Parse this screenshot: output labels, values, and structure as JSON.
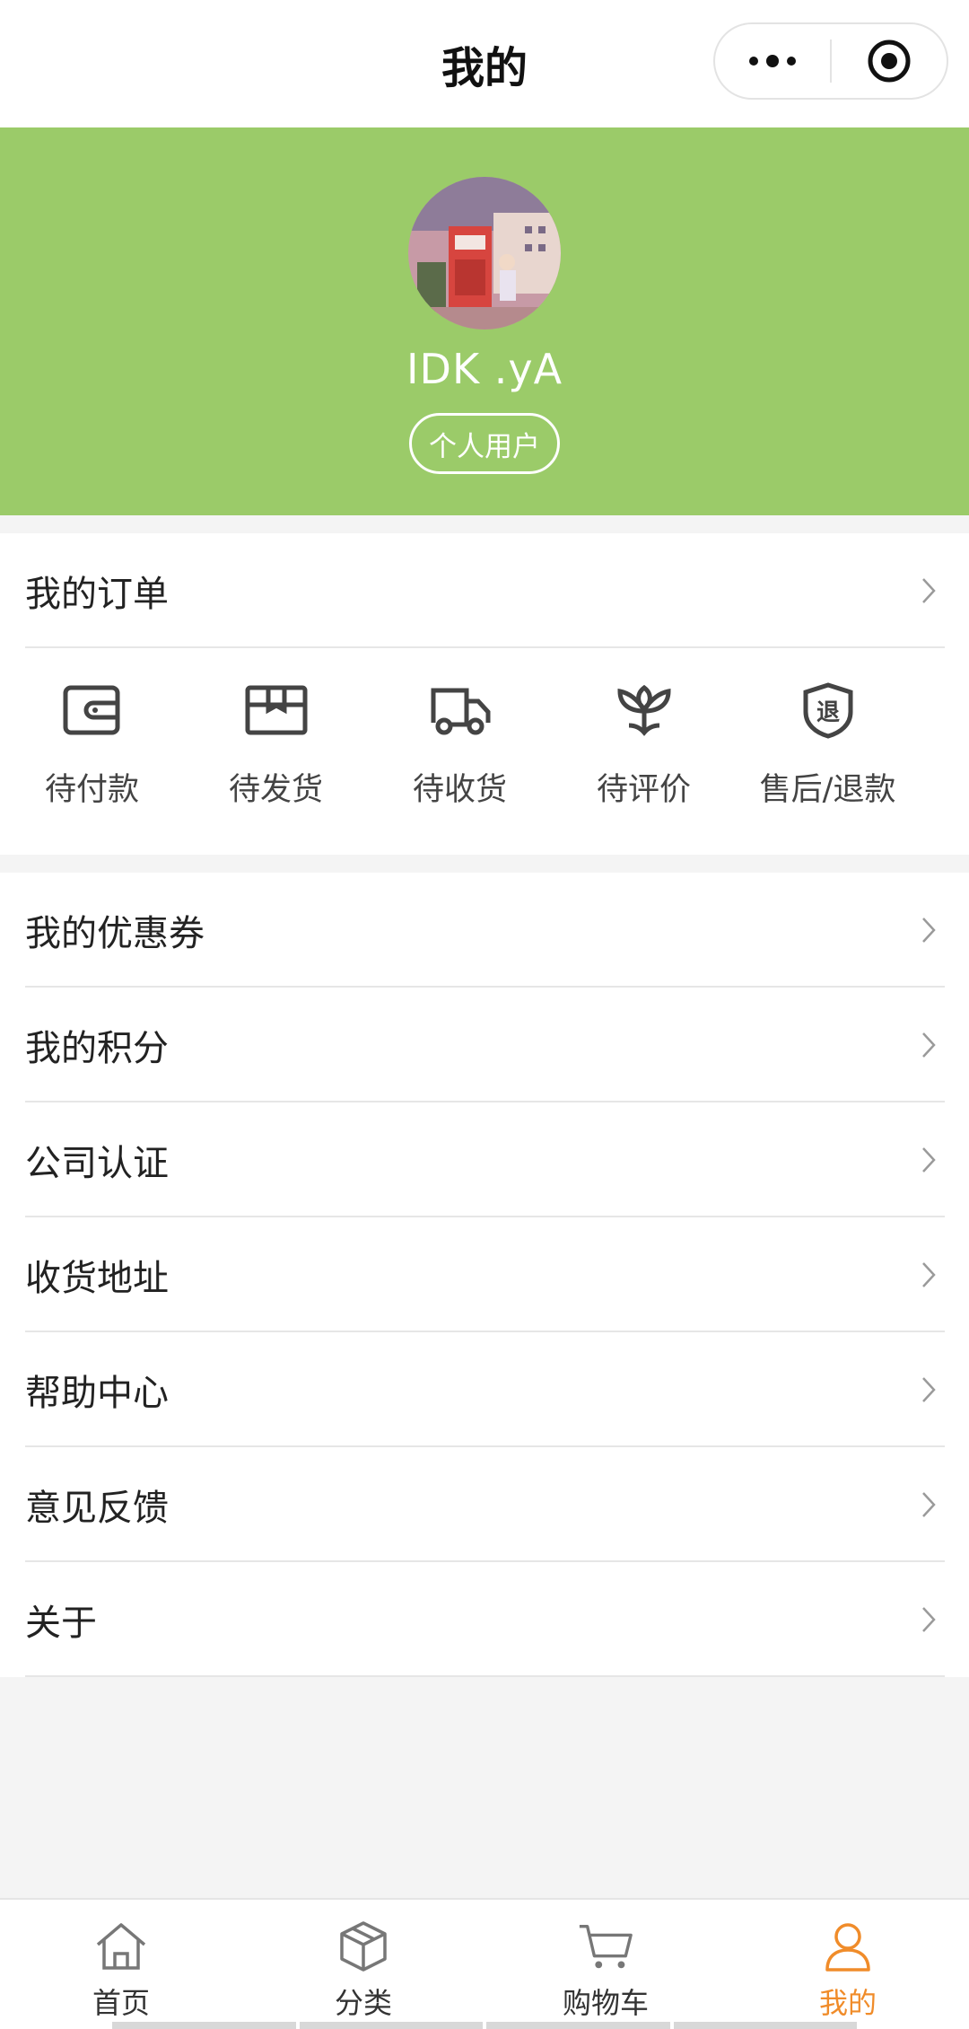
{
  "navbar": {
    "title": "我的"
  },
  "profile": {
    "username": "IDK .yA",
    "badge": "个人用户",
    "bg_color": "#9bcb69"
  },
  "orders": {
    "header": "我的订单",
    "statuses": [
      {
        "label": "待付款",
        "icon": "wallet-icon"
      },
      {
        "label": "待发货",
        "icon": "box-icon"
      },
      {
        "label": "待收货",
        "icon": "truck-icon"
      },
      {
        "label": "待评价",
        "icon": "flower-icon"
      },
      {
        "label": "售后/退款",
        "icon": "refund-shield-icon",
        "glyph": "退"
      }
    ]
  },
  "menu": {
    "items": [
      {
        "label": "我的优惠券"
      },
      {
        "label": "我的积分"
      },
      {
        "label": "公司认证"
      },
      {
        "label": "收货地址"
      },
      {
        "label": "帮助中心"
      },
      {
        "label": "意见反馈"
      },
      {
        "label": "关于"
      }
    ]
  },
  "tabbar": {
    "active_color": "#f08c2a",
    "items": [
      {
        "label": "首页",
        "icon": "home-icon",
        "active": false
      },
      {
        "label": "分类",
        "icon": "cube-icon",
        "active": false
      },
      {
        "label": "购物车",
        "icon": "cart-icon",
        "active": false
      },
      {
        "label": "我的",
        "icon": "user-icon",
        "active": true
      }
    ]
  }
}
